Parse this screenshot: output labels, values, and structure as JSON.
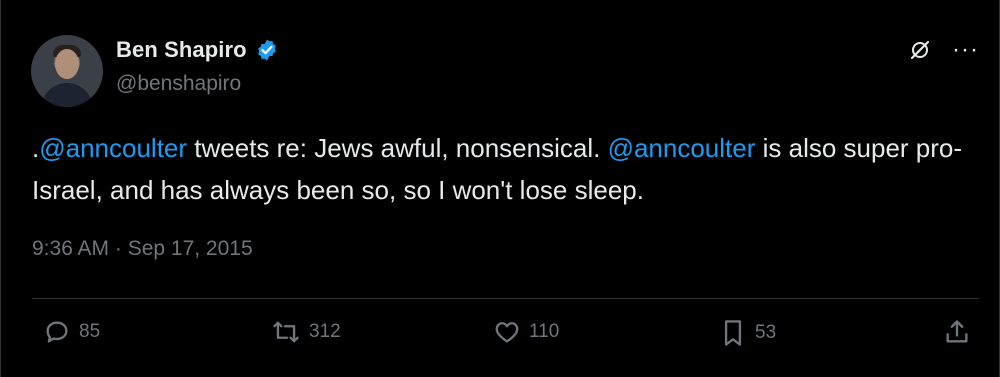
{
  "author": {
    "display_name": "Ben Shapiro",
    "handle": "@benshapiro",
    "verified": true
  },
  "tweet": {
    "segments": [
      {
        "text": ".",
        "type": "text"
      },
      {
        "text": "@anncoulter",
        "type": "mention"
      },
      {
        "text": " tweets re: Jews awful, nonsensical. ",
        "type": "text"
      },
      {
        "text": "@anncoulter",
        "type": "mention"
      },
      {
        "text": " is also super pro-Israel, and has always been so, so I won't lose sleep.",
        "type": "text"
      }
    ],
    "timestamp": "9:36 AM · Sep 17, 2015"
  },
  "actions": {
    "replies": "85",
    "reposts": "312",
    "likes": "110",
    "bookmarks": "53"
  },
  "top_actions": {
    "grok_icon": "grok-icon",
    "more_icon": "more-icon"
  },
  "colors": {
    "background": "#000000",
    "text": "#e7e9ea",
    "muted": "#71767b",
    "accent": "#1d9bf0",
    "border": "#2f3336"
  }
}
